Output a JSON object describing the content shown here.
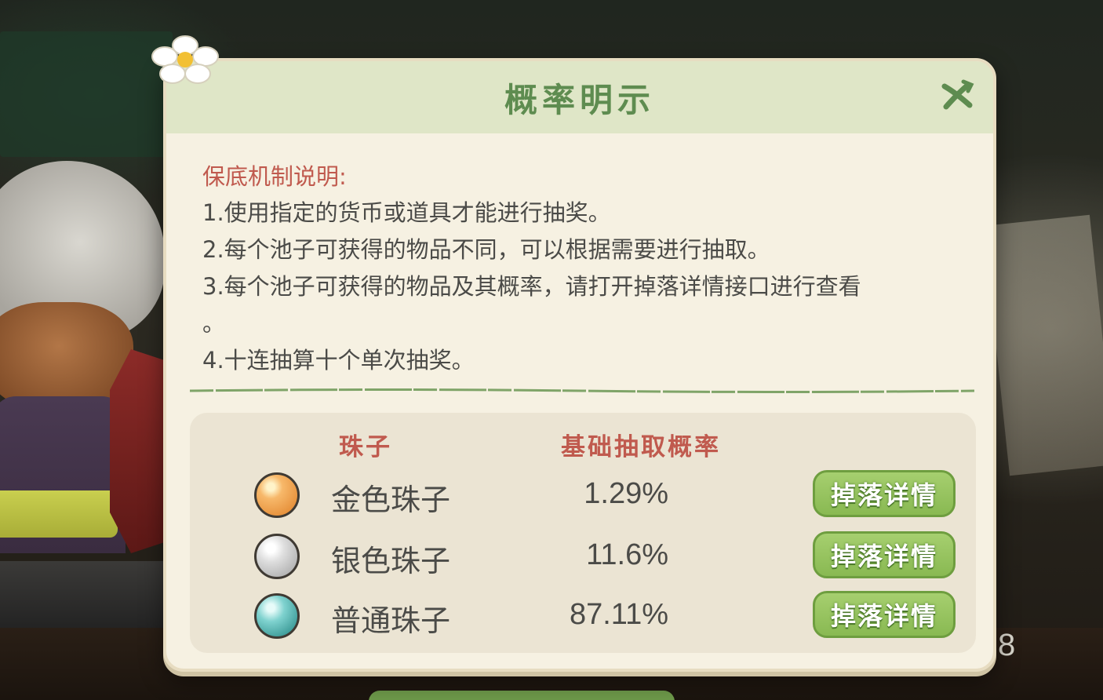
{
  "dialog": {
    "title": "概率明示",
    "close_icon": "close-x-icon",
    "decoration_icon": "daisy-flower-icon"
  },
  "rules": {
    "heading": "保底机制说明:",
    "lines": [
      "1.使用指定的货币或道具才能进行抽奖。",
      "2.每个池子可获得的物品不同，可以根据需要进行抽取。",
      "3.每个池子可获得的物品及其概率，请打开掉落详情接口进行查看",
      "。",
      "4.十连抽算十个单次抽奖。"
    ]
  },
  "table": {
    "headers": {
      "bead": "珠子",
      "rate": "基础抽取概率"
    },
    "rows": [
      {
        "name": "金色珠子",
        "rate": "1.29%",
        "icon": "gold-bead-icon",
        "button": "掉落详情"
      },
      {
        "name": "银色珠子",
        "rate": "11.6%",
        "icon": "silver-bead-icon",
        "button": "掉落详情"
      },
      {
        "name": "普通珠子",
        "rate": "87.11%",
        "icon": "common-bead-icon",
        "button": "掉落详情"
      }
    ]
  },
  "background": {
    "counter_number": "8"
  },
  "colors": {
    "title_green": "#5e8c50",
    "heading_red": "#c05a4e",
    "button_green": "#89b952",
    "panel_bg": "#f6f1e2"
  }
}
